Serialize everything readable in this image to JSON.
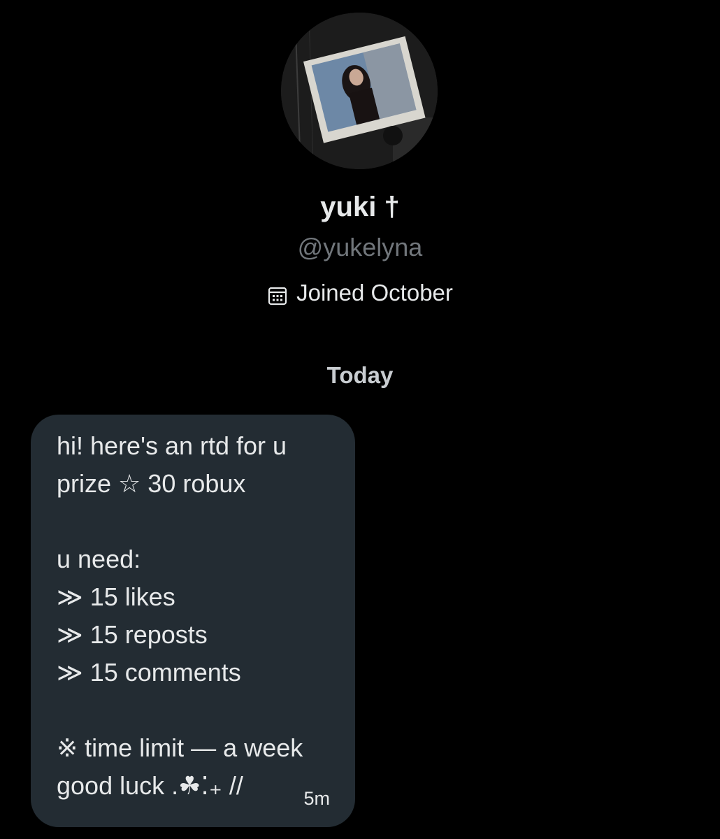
{
  "profile": {
    "display_name": "yuki †",
    "handle": "@yukelyna",
    "joined_text": "Joined October",
    "calendar_icon": "calendar-icon"
  },
  "conversation": {
    "day_separator": "Today",
    "message": {
      "lines": [
        "hi! here's an rtd for u",
        "prize ☆ 30 robux",
        "",
        "u need:",
        "≫ 15 likes",
        "≫ 15 reposts",
        "≫ 15 comments",
        "",
        "※ time limit — a week",
        "good luck .☘⁚₊ //"
      ],
      "timestamp": "5m"
    }
  },
  "colors": {
    "background": "#000000",
    "bubble": "#232c33",
    "text_primary": "#e7e9ea",
    "text_secondary": "#71767b"
  }
}
